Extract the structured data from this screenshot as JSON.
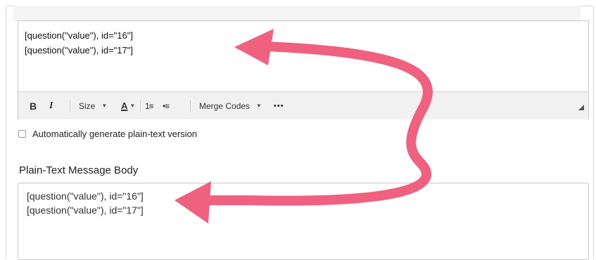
{
  "html_editor": {
    "lines": [
      "[question(\"value\"), id=\"16\"]",
      "[question(\"value\"), id=\"17\"]"
    ]
  },
  "toolbar": {
    "bold": "B",
    "italic": "I",
    "size": "Size",
    "text_color": "A",
    "ordered_list": "1≡",
    "unordered_list": "•≡",
    "merge_codes": "Merge Codes",
    "more": "•••"
  },
  "auto_plaintext": {
    "label": "Automatically generate plain-text version",
    "checked": false
  },
  "plain_text_section": {
    "title": "Plain-Text Message Body",
    "lines": [
      "[question(\"value\"), id=\"16\"]",
      "[question(\"value\"), id=\"17\"]"
    ]
  },
  "colors": {
    "annotation_arrow": "#f0607f"
  }
}
